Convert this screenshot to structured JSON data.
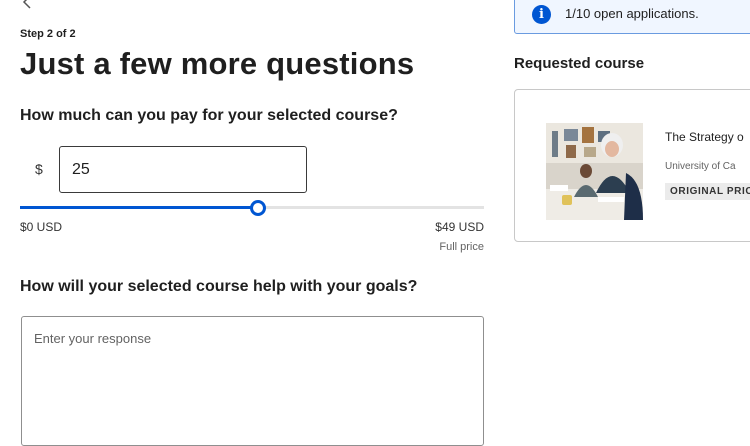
{
  "form": {
    "step_label": "Step 2 of 2",
    "title": "Just a few more questions",
    "payment_question": "How much can you pay for your selected course?",
    "currency_symbol": "$",
    "amount_value": "25",
    "slider": {
      "min_label": "$0 USD",
      "max_label": "$49 USD",
      "max_sublabel": "Full price",
      "value_fraction": 0.51
    },
    "goals_question": "How will your selected course help with your goals?",
    "response_placeholder": "Enter your response"
  },
  "sidebar": {
    "banner_text": "1/10 open applications.",
    "requested_heading": "Requested course",
    "course": {
      "title": "The Strategy o",
      "partner": "University of Ca",
      "badge": "ORIGINAL PRIC"
    }
  },
  "colors": {
    "accent": "#0056d2",
    "banner_bg": "#f0f6ff",
    "banner_border": "#6a9be0"
  },
  "icons": {
    "back": "chevron-left-icon",
    "info": "info-icon"
  }
}
